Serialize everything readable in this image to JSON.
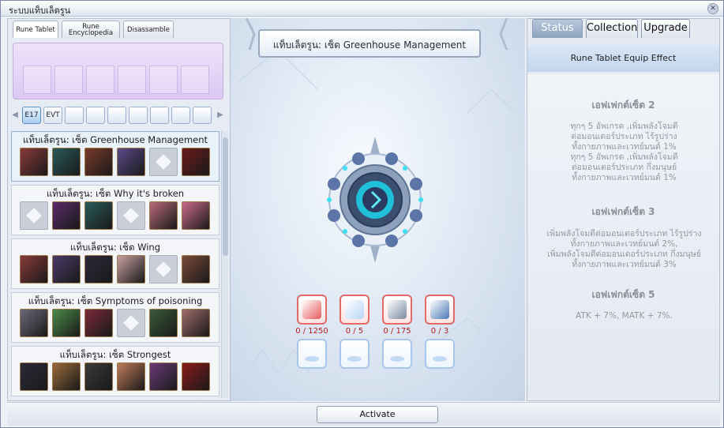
{
  "window": {
    "title": "ระบบแท็บเล็ตรูน"
  },
  "left": {
    "tabs": [
      {
        "label": "Rune Tablet",
        "active": true
      },
      {
        "label": "Rune Encyclopedia",
        "active": false
      },
      {
        "label": "Disassamble",
        "active": false
      }
    ],
    "filters": [
      "E17",
      "EVT",
      "",
      "",
      "",
      "",
      "",
      "",
      ""
    ],
    "sets": [
      {
        "name": "แท็บเล็ตรูน: เซ็ต Greenhouse Management",
        "cards": [
          "#8a3a3a",
          "#2a5a5a",
          "#7a3a2a",
          "#5a4a8a",
          "blank",
          "#6a1a1a"
        ]
      },
      {
        "name": "แท็บเล็ตรูน: เซ็ต Why it's broken",
        "cards": [
          "blank",
          "#5a2a6a",
          "#2a5a5a",
          "blank",
          "#b86a7a",
          "#c86a8a"
        ]
      },
      {
        "name": "แท็บเล็ตรูน: เซ็ต Wing",
        "cards": [
          "#8a3a3a",
          "#4a3a6a",
          "#2a2a3a",
          "#caa0a0",
          "blank",
          "#7a4a3a"
        ]
      },
      {
        "name": "แท็บเล็ตรูน: เซ็ต Symptoms of poisoning",
        "cards": [
          "#6a6a7a",
          "#4a8a4a",
          "#7a2a3a",
          "blank",
          "#3a5a3a",
          "#a06a6a"
        ]
      },
      {
        "name": "แท็บเล็ตรูน: เซ็ต Strongest",
        "cards": [
          "#2a2a3a",
          "#9a6a3a",
          "#3a3a3a",
          "#c07a5a",
          "#6a3a7a",
          "#8a1a1a"
        ]
      }
    ]
  },
  "center": {
    "banner": "แท็บเล็ตรูน: เซ็ต Greenhouse Management",
    "materials": [
      {
        "count": "0 / 1250",
        "color": "#e85a5a"
      },
      {
        "count": "0 / 5",
        "color": "#b8d8f8"
      },
      {
        "count": "0 / 175",
        "color": "#7a8aa0"
      },
      {
        "count": "0 / 3",
        "color": "#4a7ab8"
      }
    ]
  },
  "right": {
    "tabs": [
      {
        "label": "Status",
        "active": true
      },
      {
        "label": "Collection",
        "active": false
      },
      {
        "label": "Upgrade",
        "active": false
      }
    ],
    "effect_header": "Rune Tablet Equip Effect",
    "effects": {
      "set2_title": "เอฟเฟกต์เซ็ต 2",
      "set2_lines": [
        "ทุกๆ 5 อัพเกรด ,เพิ่มพลังโจมตี",
        "ต่อมอนเตอร์ประเภท ไร้รูปร่าง",
        "ทั้งกายภาพและเวทย์มนต์ 1%",
        "ทุกๆ 5 อัพเกรด ,เพิ่มพลังโจมตี",
        "ต่อมอนเตอร์ประเภท กึ่งมนุษย์",
        "ทั้งกายภาพและเวทย์มนต์ 1%"
      ],
      "set3_title": "เอฟเฟกต์เซ็ต 3",
      "set3_lines": [
        "เพิ่มพลังโจมตีต่อมอนเตอร์ประเภท ไร้รูปร่าง",
        "ทั้งกายภาพและเวทย์มนต์ 2%,",
        "เพิ่มพลังโจมตีต่อมอนเตอร์ประเภท กึ่งมนุษย์",
        "ทั้งกายภาพและเวทย์มนต์ 3%"
      ],
      "set5_title": "เอฟเฟกต์เซ็ต 5",
      "set5_lines": [
        "ATK + 7%, MATK + 7%."
      ]
    }
  },
  "bottom": {
    "activate_label": "Activate"
  }
}
